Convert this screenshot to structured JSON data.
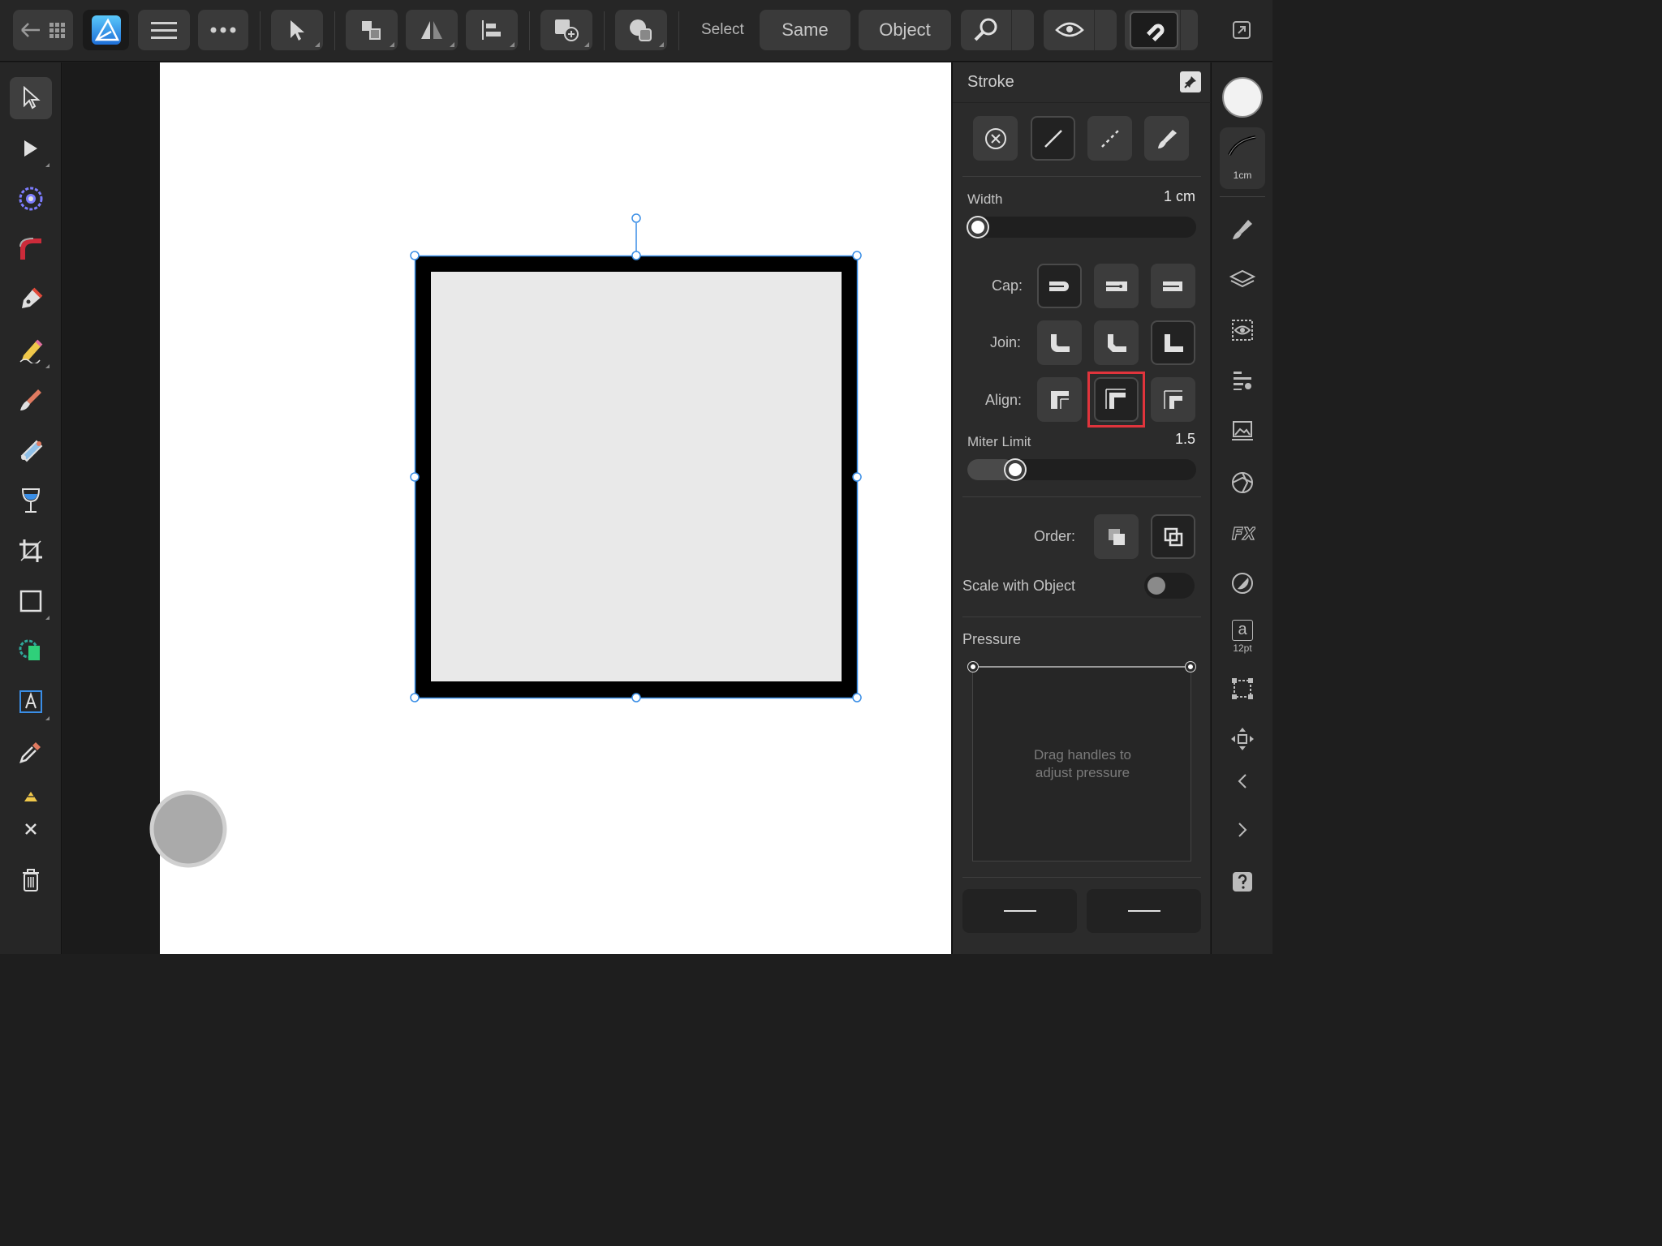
{
  "toolbar": {
    "select_label": "Select",
    "same_label": "Same",
    "object_label": "Object"
  },
  "stroke_panel": {
    "title": "Stroke",
    "width_label": "Width",
    "width_value": "1 cm",
    "width_fraction": 0.0,
    "cap_label": "Cap:",
    "join_label": "Join:",
    "align_label": "Align:",
    "miter_label": "Miter Limit",
    "miter_value": "1.5",
    "miter_fraction": 0.18,
    "order_label": "Order:",
    "scale_label": "Scale with Object",
    "scale_enabled": false,
    "pressure_label": "Pressure",
    "pressure_hint_line1": "Drag handles to",
    "pressure_hint_line2": "adjust pressure",
    "selected_align": "center"
  },
  "right_strip": {
    "brush_size_label": "1cm",
    "text_size_label": "12pt",
    "text_glyph": "a",
    "fx_label": "FX"
  },
  "colors": {
    "accent_blue": "#3a8ee6",
    "highlight_red": "#e0343c",
    "fill_swatch": "#f2f2f2",
    "shape_fill": "#e9e9e9",
    "shape_stroke": "#000000"
  }
}
